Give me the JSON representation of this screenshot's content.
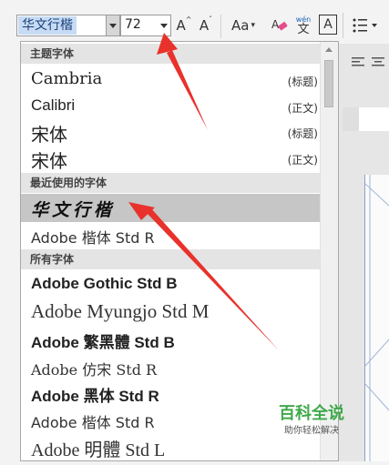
{
  "ribbon": {
    "font_name": "华文行楷",
    "font_size": "72",
    "grow_font": "A",
    "shrink_font": "A",
    "change_case": "Aa",
    "phonetic_top": "wén",
    "phonetic_bottom": "文",
    "char_border": "A"
  },
  "dropdown": {
    "theme_header": "主题字体",
    "theme_fonts": [
      {
        "name": "Cambria",
        "tag": "(标题)"
      },
      {
        "name": "Calibri",
        "tag": "(正文)"
      },
      {
        "name": "宋体",
        "tag": "(标题)"
      },
      {
        "name": "宋体",
        "tag": "(正文)"
      }
    ],
    "recent_header": "最近使用的字体",
    "recent_fonts": [
      "华文行楷",
      "Adobe 楷体 Std R"
    ],
    "all_header": "所有字体",
    "all_fonts": [
      "Adobe Gothic Std B",
      "Adobe Myungjo Std M",
      "Adobe 繁黑體 Std B",
      "Adobe 仿宋 Std R",
      "Adobe 黑体 Std R",
      "Adobe 楷体 Std R",
      "Adobe 明體 Std L"
    ]
  },
  "watermark": {
    "title": "百科全说",
    "subtitle": "助你轻松解决"
  },
  "colors": {
    "arrow": "#e8322b",
    "selected": "#c6c6c6",
    "header": "#e4e4e4",
    "logo_green": "#3fa94a"
  }
}
